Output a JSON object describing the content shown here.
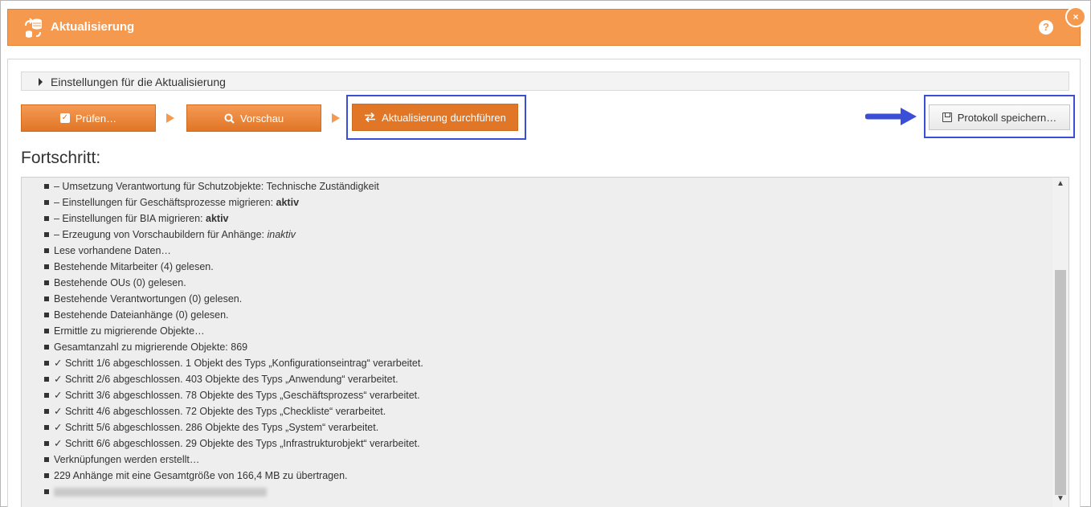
{
  "window": {
    "title": "Aktualisierung",
    "help_glyph": "?",
    "close_glyph": "×",
    "accent_color": "#f5994f"
  },
  "settings": {
    "label": "Einstellungen für die Aktualisierung"
  },
  "toolbar": {
    "check_label": "Prüfen…",
    "preview_label": "Vorschau",
    "run_label": "Aktualisierung durchführen",
    "save_label": "Protokoll speichern…",
    "highlight_color": "#3a4fd6"
  },
  "progress": {
    "title": "Fortschritt:",
    "log": [
      {
        "text": "– Umsetzung Verantwortung für Schutzobjekte: Technische Zuständigkeit",
        "emph": "",
        "style": ""
      },
      {
        "text": "– Einstellungen für Geschäftsprozesse migrieren: ",
        "emph": "aktiv",
        "style": "bold"
      },
      {
        "text": "– Einstellungen für BIA migrieren: ",
        "emph": "aktiv",
        "style": "bold"
      },
      {
        "text": "– Erzeugung von Vorschaubildern für Anhänge: ",
        "emph": "inaktiv",
        "style": "italic"
      },
      {
        "text": "Lese vorhandene Daten…",
        "emph": "",
        "style": ""
      },
      {
        "text": "Bestehende Mitarbeiter (4) gelesen.",
        "emph": "",
        "style": ""
      },
      {
        "text": "Bestehende OUs (0) gelesen.",
        "emph": "",
        "style": ""
      },
      {
        "text": "Bestehende Verantwortungen (0) gelesen.",
        "emph": "",
        "style": ""
      },
      {
        "text": "Bestehende Dateianhänge (0) gelesen.",
        "emph": "",
        "style": ""
      },
      {
        "text": "Ermittle zu migrierende Objekte…",
        "emph": "",
        "style": ""
      },
      {
        "text": "Gesamtanzahl zu migrierende Objekte: 869",
        "emph": "",
        "style": ""
      },
      {
        "text": "✓ Schritt 1/6 abgeschlossen. 1 Objekt des Typs „Konfigurationseintrag“ verarbeitet.",
        "emph": "",
        "style": ""
      },
      {
        "text": "✓ Schritt 2/6 abgeschlossen. 403 Objekte des Typs „Anwendung“ verarbeitet.",
        "emph": "",
        "style": ""
      },
      {
        "text": "✓ Schritt 3/6 abgeschlossen. 78 Objekte des Typs „Geschäftsprozess“ verarbeitet.",
        "emph": "",
        "style": ""
      },
      {
        "text": "✓ Schritt 4/6 abgeschlossen. 72 Objekte des Typs „Checkliste“ verarbeitet.",
        "emph": "",
        "style": ""
      },
      {
        "text": "✓ Schritt 5/6 abgeschlossen. 286 Objekte des Typs „System“ verarbeitet.",
        "emph": "",
        "style": ""
      },
      {
        "text": "✓ Schritt 6/6 abgeschlossen. 29 Objekte des Typs „Infrastrukturobjekt“ verarbeitet.",
        "emph": "",
        "style": ""
      },
      {
        "text": "Verknüpfungen werden erstellt…",
        "emph": "",
        "style": ""
      },
      {
        "text": "229 Anhänge mit eine Gesamtgröße von 166,4 MB zu übertragen.",
        "emph": "",
        "style": ""
      }
    ]
  }
}
